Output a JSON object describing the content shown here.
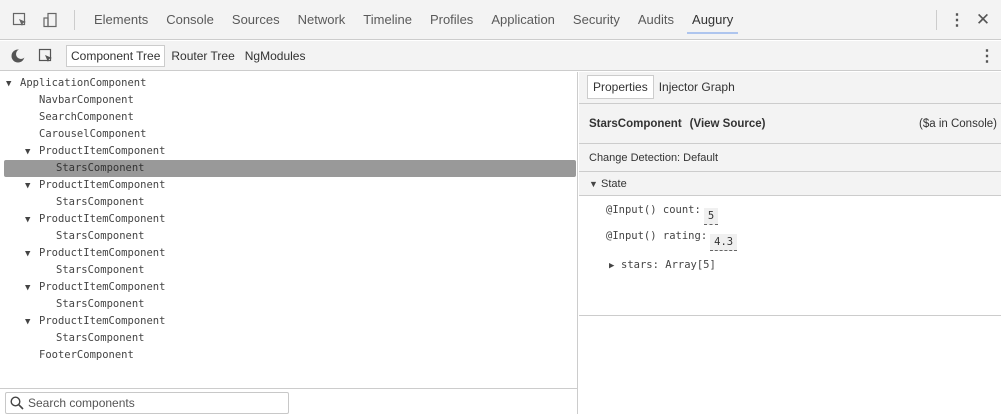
{
  "devtools": {
    "tabs": [
      "Elements",
      "Console",
      "Sources",
      "Network",
      "Timeline",
      "Profiles",
      "Application",
      "Security",
      "Audits",
      "Augury"
    ],
    "active_tab": "Augury"
  },
  "augury": {
    "tabs": [
      "Component Tree",
      "Router Tree",
      "NgModules"
    ],
    "active_tab": "Component Tree"
  },
  "tree": [
    {
      "label": "ApplicationComponent",
      "caret": "▼"
    },
    {
      "label": "NavbarComponent",
      "caret": ""
    },
    {
      "label": "SearchComponent",
      "caret": ""
    },
    {
      "label": "CarouselComponent",
      "caret": ""
    },
    {
      "label": "ProductItemComponent",
      "caret": "▼"
    },
    {
      "label": "StarsComponent",
      "caret": ""
    },
    {
      "label": "ProductItemComponent",
      "caret": "▼"
    },
    {
      "label": "StarsComponent",
      "caret": ""
    },
    {
      "label": "ProductItemComponent",
      "caret": "▼"
    },
    {
      "label": "StarsComponent",
      "caret": ""
    },
    {
      "label": "ProductItemComponent",
      "caret": "▼"
    },
    {
      "label": "StarsComponent",
      "caret": ""
    },
    {
      "label": "ProductItemComponent",
      "caret": "▼"
    },
    {
      "label": "StarsComponent",
      "caret": ""
    },
    {
      "label": "ProductItemComponent",
      "caret": "▼"
    },
    {
      "label": "StarsComponent",
      "caret": ""
    },
    {
      "label": "FooterComponent",
      "caret": ""
    }
  ],
  "search": {
    "placeholder": "Search components"
  },
  "properties": {
    "tabs": [
      "Properties",
      "Injector Graph"
    ],
    "active_tab": "Properties",
    "component_name": "StarsComponent",
    "view_source": "(View Source)",
    "console_hint": "($a in Console)",
    "change_detection": "Change Detection: Default",
    "state_label": "State",
    "state_caret": "▼",
    "count_label": "@Input() count:",
    "count_value": "5",
    "rating_label": "@Input() rating:",
    "rating_value": "4.3",
    "stars_caret": "▶",
    "stars_label": "stars: Array[5]"
  },
  "colors": {
    "toolbar_bg": "#f3f3f3",
    "selected_row": "#999999",
    "border": "#cccccc"
  }
}
